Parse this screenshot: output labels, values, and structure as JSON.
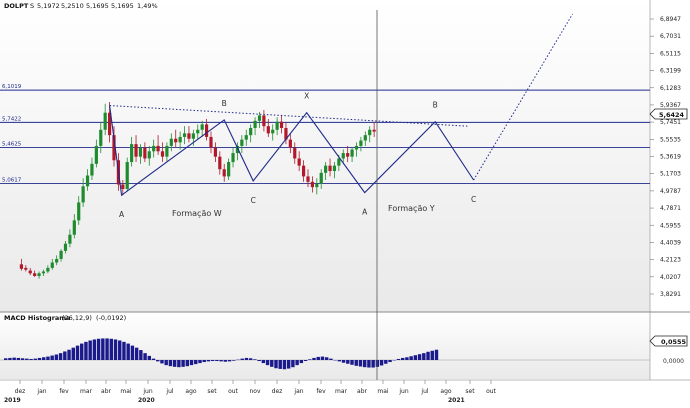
{
  "header": {
    "symbol": "DOLPT",
    "interval": "S",
    "open": "5,1972",
    "high": "5,2510",
    "low": "5,1695",
    "close": "5,1695",
    "change": "1,49%"
  },
  "last_price_label": "5,6424",
  "macd": {
    "title": "MACD Histograma",
    "params": "(26,12,9)",
    "last": "(-0,0192)",
    "axis_ticks": [
      "0,0555",
      "0,0000"
    ],
    "axis_values": [
      0.0555,
      0
    ],
    "bars": [
      0.005,
      0.006,
      0.007,
      0.006,
      0.005,
      0.004,
      0.003,
      0.004,
      0.006,
      0.008,
      0.01,
      0.013,
      0.016,
      0.02,
      0.025,
      0.03,
      0.036,
      0.042,
      0.048,
      0.053,
      0.057,
      0.06,
      0.062,
      0.063,
      0.063,
      0.062,
      0.06,
      0.057,
      0.053,
      0.048,
      0.042,
      0.036,
      0.029,
      0.02,
      0.012,
      0.004,
      -0.004,
      -0.01,
      -0.015,
      -0.018,
      -0.02,
      -0.021,
      -0.02,
      -0.018,
      -0.015,
      -0.012,
      -0.009,
      -0.006,
      -0.004,
      -0.003,
      -0.003,
      -0.004,
      -0.005,
      -0.004,
      -0.002,
      0.001,
      0.004,
      0.006,
      0.005,
      0.002,
      -0.003,
      -0.009,
      -0.015,
      -0.02,
      -0.024,
      -0.026,
      -0.027,
      -0.025,
      -0.021,
      -0.015,
      -0.009,
      -0.003,
      0.002,
      0.006,
      0.009,
      0.01,
      0.008,
      0.004,
      0.0,
      -0.004,
      -0.008,
      -0.011,
      -0.014,
      -0.017,
      -0.019,
      -0.021,
      -0.022,
      -0.022,
      -0.02,
      -0.016,
      -0.011,
      -0.006,
      -0.001,
      0.003,
      0.006,
      0.008,
      0.011,
      0.014,
      0.017,
      0.02,
      0.024,
      0.027,
      0.03
    ]
  },
  "price_axis": {
    "left_labels": [
      "6,1019",
      "5,7422",
      "5,4625",
      "5,0617"
    ],
    "left_values": [
      6.1019,
      5.7422,
      5.4625,
      5.0617
    ],
    "right_ticks": [
      "6,8947",
      "6,7031",
      "6,5115",
      "6,3199",
      "6,1283",
      "5,9367",
      "5,7451",
      "5,5535",
      "5,3619",
      "5,1703",
      "4,9787",
      "4,7871",
      "4,5955",
      "4,4039",
      "4,2123",
      "4,0207",
      "3,8291"
    ],
    "right_values": [
      6.8947,
      6.7031,
      6.5115,
      6.3199,
      6.1283,
      5.9367,
      5.7451,
      5.5535,
      5.3619,
      5.1703,
      4.9787,
      4.7871,
      4.5955,
      4.4039,
      4.2123,
      4.0207,
      3.8291
    ]
  },
  "months": [
    "dez",
    "jan",
    "fev",
    "mar",
    "abr",
    "mai",
    "jun",
    "jul",
    "ago",
    "set",
    "out",
    "nov",
    "dez",
    "jan",
    "fev",
    "mar",
    "abr",
    "mai",
    "jun",
    "jul",
    "ago",
    "set",
    "out"
  ],
  "years": [
    "2019",
    "2020",
    "2021"
  ],
  "annotations": {
    "formacao_w": "Formação W",
    "formacao_y": "Formação Y",
    "points": [
      {
        "label": "A",
        "date": "2020-05-15",
        "price": 4.93
      },
      {
        "label": "B",
        "date": "2020-10-25",
        "price": 5.77
      },
      {
        "label": "C",
        "date": "2020-12-10",
        "price": 5.09
      },
      {
        "label": "X",
        "date": "2021-03-05",
        "price": 5.85
      },
      {
        "label": "A",
        "date": "2021-06-05",
        "price": 4.96
      },
      {
        "label": "B",
        "date": "2021-09-25",
        "price": 5.75
      },
      {
        "label": "C",
        "date": "2021-11-25",
        "price": 5.1
      }
    ]
  },
  "chart_data": {
    "type": "candlestick",
    "symbol": "DOLPT",
    "x_axis": "weekly dates, Dec 2019 - Jan 2022 (projection)",
    "y_range": [
      3.75,
      7.0
    ],
    "candles": [
      {
        "date": "2019-12-08",
        "open": 4.16,
        "high": 4.22,
        "low": 4.09,
        "close": 4.11
      },
      {
        "date": "2019-12-15",
        "open": 4.12,
        "high": 4.15,
        "low": 4.08,
        "close": 4.1
      },
      {
        "date": "2019-12-22",
        "open": 4.09,
        "high": 4.12,
        "low": 4.04,
        "close": 4.06
      },
      {
        "date": "2019-12-29",
        "open": 4.06,
        "high": 4.09,
        "low": 4.02,
        "close": 4.03
      },
      {
        "date": "2020-01-05",
        "open": 4.03,
        "high": 4.08,
        "low": 4.0,
        "close": 4.06
      },
      {
        "date": "2020-01-12",
        "open": 4.06,
        "high": 4.1,
        "low": 4.03,
        "close": 4.08
      },
      {
        "date": "2020-01-19",
        "open": 4.08,
        "high": 4.15,
        "low": 4.06,
        "close": 4.12
      },
      {
        "date": "2020-01-26",
        "open": 4.12,
        "high": 4.22,
        "low": 4.1,
        "close": 4.18
      },
      {
        "date": "2020-02-02",
        "open": 4.18,
        "high": 4.26,
        "low": 4.15,
        "close": 4.22
      },
      {
        "date": "2020-02-09",
        "open": 4.22,
        "high": 4.33,
        "low": 4.19,
        "close": 4.31
      },
      {
        "date": "2020-02-16",
        "open": 4.31,
        "high": 4.42,
        "low": 4.28,
        "close": 4.39
      },
      {
        "date": "2020-02-23",
        "open": 4.39,
        "high": 4.55,
        "low": 4.35,
        "close": 4.49
      },
      {
        "date": "2020-03-01",
        "open": 4.49,
        "high": 4.72,
        "low": 4.45,
        "close": 4.65
      },
      {
        "date": "2020-03-08",
        "open": 4.65,
        "high": 4.92,
        "low": 4.6,
        "close": 4.85
      },
      {
        "date": "2020-03-15",
        "open": 4.85,
        "high": 5.12,
        "low": 4.8,
        "close": 5.03
      },
      {
        "date": "2020-03-22",
        "open": 5.03,
        "high": 5.22,
        "low": 4.98,
        "close": 5.15
      },
      {
        "date": "2020-03-29",
        "open": 5.15,
        "high": 5.35,
        "low": 5.1,
        "close": 5.28
      },
      {
        "date": "2020-04-05",
        "open": 5.28,
        "high": 5.55,
        "low": 5.24,
        "close": 5.48
      },
      {
        "date": "2020-04-12",
        "open": 5.48,
        "high": 5.75,
        "low": 5.4,
        "close": 5.66
      },
      {
        "date": "2020-04-19",
        "open": 5.66,
        "high": 5.95,
        "low": 5.6,
        "close": 5.85
      },
      {
        "date": "2020-04-26",
        "open": 5.85,
        "high": 5.97,
        "low": 5.52,
        "close": 5.6
      },
      {
        "date": "2020-05-03",
        "open": 5.6,
        "high": 5.7,
        "low": 5.25,
        "close": 5.32
      },
      {
        "date": "2020-05-10",
        "open": 5.32,
        "high": 5.4,
        "low": 4.98,
        "close": 5.05
      },
      {
        "date": "2020-05-17",
        "open": 5.05,
        "high": 5.1,
        "low": 4.93,
        "close": 5.0
      },
      {
        "date": "2020-05-24",
        "open": 5.0,
        "high": 5.35,
        "low": 4.97,
        "close": 5.3
      },
      {
        "date": "2020-05-31",
        "open": 5.3,
        "high": 5.58,
        "low": 5.25,
        "close": 5.5
      },
      {
        "date": "2020-06-07",
        "open": 5.5,
        "high": 5.6,
        "low": 5.3,
        "close": 5.36
      },
      {
        "date": "2020-06-14",
        "open": 5.36,
        "high": 5.5,
        "low": 5.28,
        "close": 5.46
      },
      {
        "date": "2020-06-21",
        "open": 5.46,
        "high": 5.52,
        "low": 5.3,
        "close": 5.34
      },
      {
        "date": "2020-06-28",
        "open": 5.34,
        "high": 5.48,
        "low": 5.26,
        "close": 5.42
      },
      {
        "date": "2020-07-05",
        "open": 5.42,
        "high": 5.55,
        "low": 5.35,
        "close": 5.48
      },
      {
        "date": "2020-07-12",
        "open": 5.48,
        "high": 5.6,
        "low": 5.38,
        "close": 5.42
      },
      {
        "date": "2020-07-19",
        "open": 5.42,
        "high": 5.52,
        "low": 5.3,
        "close": 5.36
      },
      {
        "date": "2020-07-26",
        "open": 5.36,
        "high": 5.52,
        "low": 5.3,
        "close": 5.48
      },
      {
        "date": "2020-08-02",
        "open": 5.48,
        "high": 5.62,
        "low": 5.42,
        "close": 5.56
      },
      {
        "date": "2020-08-09",
        "open": 5.56,
        "high": 5.66,
        "low": 5.46,
        "close": 5.52
      },
      {
        "date": "2020-08-16",
        "open": 5.52,
        "high": 5.64,
        "low": 5.44,
        "close": 5.58
      },
      {
        "date": "2020-08-23",
        "open": 5.58,
        "high": 5.7,
        "low": 5.5,
        "close": 5.62
      },
      {
        "date": "2020-08-30",
        "open": 5.62,
        "high": 5.7,
        "low": 5.52,
        "close": 5.56
      },
      {
        "date": "2020-09-06",
        "open": 5.56,
        "high": 5.66,
        "low": 5.48,
        "close": 5.62
      },
      {
        "date": "2020-09-13",
        "open": 5.62,
        "high": 5.72,
        "low": 5.55,
        "close": 5.66
      },
      {
        "date": "2020-09-20",
        "open": 5.66,
        "high": 5.76,
        "low": 5.58,
        "close": 5.72
      },
      {
        "date": "2020-09-27",
        "open": 5.72,
        "high": 5.78,
        "low": 5.54,
        "close": 5.58
      },
      {
        "date": "2020-10-04",
        "open": 5.58,
        "high": 5.64,
        "low": 5.4,
        "close": 5.46
      },
      {
        "date": "2020-10-11",
        "open": 5.46,
        "high": 5.52,
        "low": 5.3,
        "close": 5.36
      },
      {
        "date": "2020-10-18",
        "open": 5.36,
        "high": 5.42,
        "low": 5.16,
        "close": 5.22
      },
      {
        "date": "2020-10-25",
        "open": 5.22,
        "high": 5.28,
        "low": 5.08,
        "close": 5.14
      },
      {
        "date": "2020-11-01",
        "open": 5.14,
        "high": 5.34,
        "low": 5.1,
        "close": 5.3
      },
      {
        "date": "2020-11-08",
        "open": 5.3,
        "high": 5.46,
        "low": 5.24,
        "close": 5.4
      },
      {
        "date": "2020-11-15",
        "open": 5.4,
        "high": 5.52,
        "low": 5.32,
        "close": 5.48
      },
      {
        "date": "2020-11-22",
        "open": 5.48,
        "high": 5.6,
        "low": 5.4,
        "close": 5.55
      },
      {
        "date": "2020-11-29",
        "open": 5.55,
        "high": 5.66,
        "low": 5.48,
        "close": 5.6
      },
      {
        "date": "2020-12-06",
        "open": 5.6,
        "high": 5.72,
        "low": 5.52,
        "close": 5.68
      },
      {
        "date": "2020-12-13",
        "open": 5.68,
        "high": 5.8,
        "low": 5.6,
        "close": 5.76
      },
      {
        "date": "2020-12-20",
        "open": 5.76,
        "high": 5.86,
        "low": 5.68,
        "close": 5.82
      },
      {
        "date": "2020-12-27",
        "open": 5.82,
        "high": 5.88,
        "low": 5.64,
        "close": 5.7
      },
      {
        "date": "2021-01-03",
        "open": 5.7,
        "high": 5.78,
        "low": 5.58,
        "close": 5.62
      },
      {
        "date": "2021-01-10",
        "open": 5.62,
        "high": 5.72,
        "low": 5.54,
        "close": 5.66
      },
      {
        "date": "2021-01-17",
        "open": 5.66,
        "high": 5.8,
        "low": 5.6,
        "close": 5.75
      },
      {
        "date": "2021-01-24",
        "open": 5.75,
        "high": 5.82,
        "low": 5.62,
        "close": 5.68
      },
      {
        "date": "2021-01-31",
        "open": 5.68,
        "high": 5.74,
        "low": 5.5,
        "close": 5.55
      },
      {
        "date": "2021-02-07",
        "open": 5.55,
        "high": 5.62,
        "low": 5.4,
        "close": 5.46
      },
      {
        "date": "2021-02-14",
        "open": 5.46,
        "high": 5.52,
        "low": 5.28,
        "close": 5.34
      },
      {
        "date": "2021-02-21",
        "open": 5.34,
        "high": 5.42,
        "low": 5.2,
        "close": 5.26
      },
      {
        "date": "2021-02-28",
        "open": 5.26,
        "high": 5.32,
        "low": 5.08,
        "close": 5.14
      },
      {
        "date": "2021-03-07",
        "open": 5.14,
        "high": 5.22,
        "low": 5.02,
        "close": 5.08
      },
      {
        "date": "2021-03-14",
        "open": 5.08,
        "high": 5.14,
        "low": 4.96,
        "close": 5.02
      },
      {
        "date": "2021-03-21",
        "open": 5.02,
        "high": 5.12,
        "low": 4.94,
        "close": 5.06
      },
      {
        "date": "2021-03-28",
        "open": 5.06,
        "high": 5.22,
        "low": 5.0,
        "close": 5.18
      },
      {
        "date": "2021-04-04",
        "open": 5.18,
        "high": 5.3,
        "low": 5.1,
        "close": 5.26
      },
      {
        "date": "2021-04-11",
        "open": 5.26,
        "high": 5.34,
        "low": 5.14,
        "close": 5.2
      },
      {
        "date": "2021-04-18",
        "open": 5.2,
        "high": 5.3,
        "low": 5.12,
        "close": 5.26
      },
      {
        "date": "2021-04-25",
        "open": 5.26,
        "high": 5.38,
        "low": 5.2,
        "close": 5.34
      },
      {
        "date": "2021-05-02",
        "open": 5.34,
        "high": 5.44,
        "low": 5.28,
        "close": 5.4
      },
      {
        "date": "2021-05-09",
        "open": 5.4,
        "high": 5.48,
        "low": 5.3,
        "close": 5.36
      },
      {
        "date": "2021-05-16",
        "open": 5.36,
        "high": 5.46,
        "low": 5.3,
        "close": 5.44
      },
      {
        "date": "2021-05-23",
        "open": 5.44,
        "high": 5.52,
        "low": 5.36,
        "close": 5.48
      },
      {
        "date": "2021-05-30",
        "open": 5.48,
        "high": 5.58,
        "low": 5.42,
        "close": 5.54
      },
      {
        "date": "2021-06-06",
        "open": 5.54,
        "high": 5.64,
        "low": 5.48,
        "close": 5.6
      },
      {
        "date": "2021-06-13",
        "open": 5.6,
        "high": 5.7,
        "low": 5.52,
        "close": 5.66
      },
      {
        "date": "2021-06-20",
        "open": 5.66,
        "high": 5.75,
        "low": 5.58,
        "close": 5.64
      }
    ],
    "horizontal_levels": [
      6.1019,
      5.7422,
      5.4625,
      5.0617
    ],
    "trendline": {
      "from": {
        "date": "2020-04-26",
        "price": 5.93
      },
      "to": {
        "date": "2021-11-15",
        "price": 5.7
      }
    },
    "projection": {
      "from": {
        "date": "2021-11-25",
        "price": 5.1
      },
      "to": {
        "date": "2022-05-01",
        "price": 6.95
      }
    }
  }
}
